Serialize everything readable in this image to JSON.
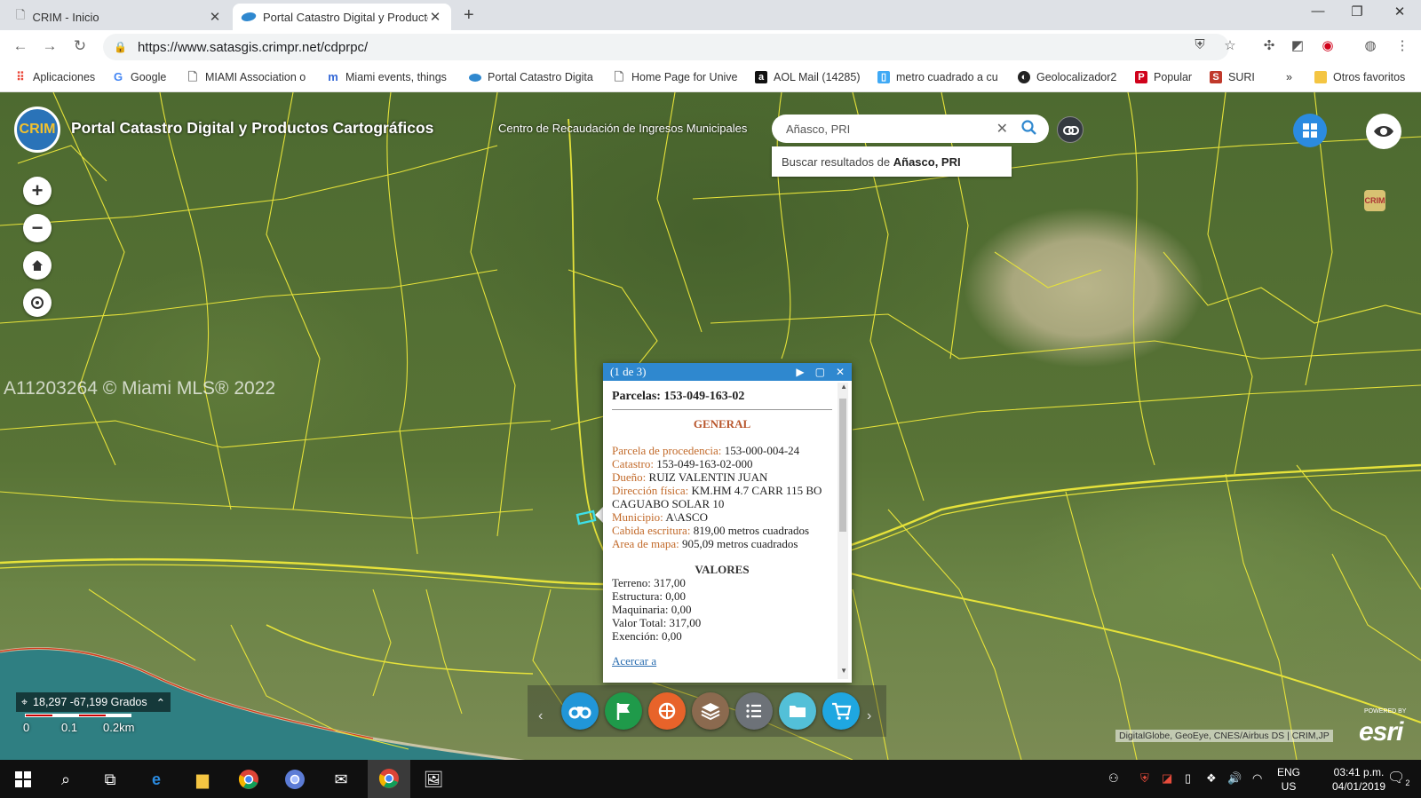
{
  "browser": {
    "tabs": [
      {
        "title": "CRIM - Inicio",
        "active": false
      },
      {
        "title": "Portal Catastro Digital y Producto",
        "active": true
      }
    ],
    "new_tab": "+",
    "url": "https://www.satasgis.crimpr.net/cdprpc/",
    "bookmarks": [
      {
        "label": "Aplicaciones",
        "icon": "apps-grid-icon",
        "color": "#4285f4"
      },
      {
        "label": "Google",
        "icon": "google-icon",
        "color": "#4285f4"
      },
      {
        "label": "MIAMI Association o",
        "icon": "page-icon",
        "color": "#888888"
      },
      {
        "label": "Miami events, things",
        "icon": "m-logo-icon",
        "color": "#3367d6"
      },
      {
        "label": "Portal Catastro Digita",
        "icon": "portal-icon",
        "color": "#2f88cf"
      },
      {
        "label": "Home Page for Unive",
        "icon": "page-icon",
        "color": "#888888"
      },
      {
        "label": "AOL Mail (14285)",
        "icon": "aol-icon",
        "color": "#111111"
      },
      {
        "label": "metro cuadrado a cu",
        "icon": "metro-icon",
        "color": "#3fa9f5"
      },
      {
        "label": "Geolocalizador2",
        "icon": "geo-icon",
        "color": "#222222"
      },
      {
        "label": "Popular",
        "icon": "popular-icon",
        "color": "#d0021b"
      },
      {
        "label": "SURI",
        "icon": "suri-icon",
        "color": "#c0392b"
      }
    ],
    "bookmarks_more": "»",
    "other_bookmarks": "Otros favoritos"
  },
  "app": {
    "logo_text": "CRIM",
    "title": "Portal Catastro Digital y Productos Cartográficos",
    "subtitle": "Centro de Recaudación de Ingresos Municipales",
    "search_value": "Añasco, PRI",
    "suggestion_prefix": "Buscar resultados de ",
    "suggestion_term": "Añasco, PRI",
    "small_logo_text": "CRIM"
  },
  "map_controls": {
    "zoom_in": "+",
    "zoom_out": "−"
  },
  "watermark": "A11203264 © Miami MLS® 2022",
  "popup": {
    "counter": "(1 de 3)",
    "title": "Parcelas: 153-049-163-02",
    "general_header": "GENERAL",
    "fields": [
      {
        "key": "Parcela de procedencia:",
        "value": " 153-000-004-24"
      },
      {
        "key": "Catastro:",
        "value": " 153-049-163-02-000"
      },
      {
        "key": "Dueño:",
        "value": " RUIZ VALENTIN JUAN"
      },
      {
        "key": "Dirección física:",
        "value": " KM.HM 4.7 CARR 115 BO CAGUABO SOLAR 10"
      },
      {
        "key": "Municipio:",
        "value": " A\\ASCO"
      },
      {
        "key": "Cabida escritura:",
        "value": " 819,00 metros cuadrados"
      },
      {
        "key": "Area de mapa:",
        "value": " 905,09 metros cuadrados"
      }
    ],
    "valores_header": "VALORES",
    "valores": [
      "Terreno: 317,00",
      "Estructura: 0,00",
      "Maquinaria: 0,00",
      "Valor Total: 317,00",
      "Exención: 0,00"
    ],
    "zoom_link": "Acercar a"
  },
  "coordinates": "18,297 -67,199 Grados",
  "scale_labels": [
    "0",
    "0.1",
    "0.2km"
  ],
  "attribution": "DigitalGlobe, GeoEye, CNES/Airbus DS | CRIM,JP",
  "esri": {
    "powered": "POWERED BY",
    "brand": "esri"
  },
  "taskbar": {
    "lang_top": "ENG",
    "lang_bottom": "US",
    "time": "03:41 p.m.",
    "date": "04/01/2019",
    "notifications": "2"
  },
  "colors": {
    "accent": "#2f88cf",
    "parcel_lines": "#e6e23a",
    "selected_parcel": "#3ee0e8",
    "section_header": "#b8562c"
  }
}
